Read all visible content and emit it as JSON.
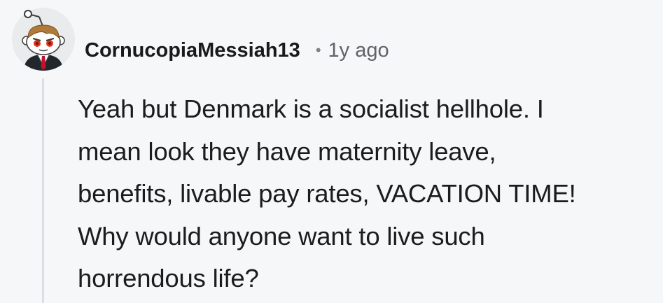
{
  "comment": {
    "author": "CornucopiaMessiah13",
    "separator": "•",
    "timestamp": "1y ago",
    "avatar_icon": "snoo-businessman-avatar",
    "body_lines": [
      "Yeah but Denmark is a socialist hellhole. I",
      "mean look they have maternity leave,",
      "benefits, livable pay rates, VACATION TIME!",
      "Why would anyone want to live such",
      "horrendous life?"
    ]
  },
  "colors": {
    "background": "#f6f7f8",
    "username": "#1a1a1b",
    "timestamp": "#5f6469",
    "body_text": "#1c1c1c",
    "thread_line": "#dcdfe2",
    "avatar_eyes": "#e0331a",
    "avatar_tie": "#c8102e"
  }
}
